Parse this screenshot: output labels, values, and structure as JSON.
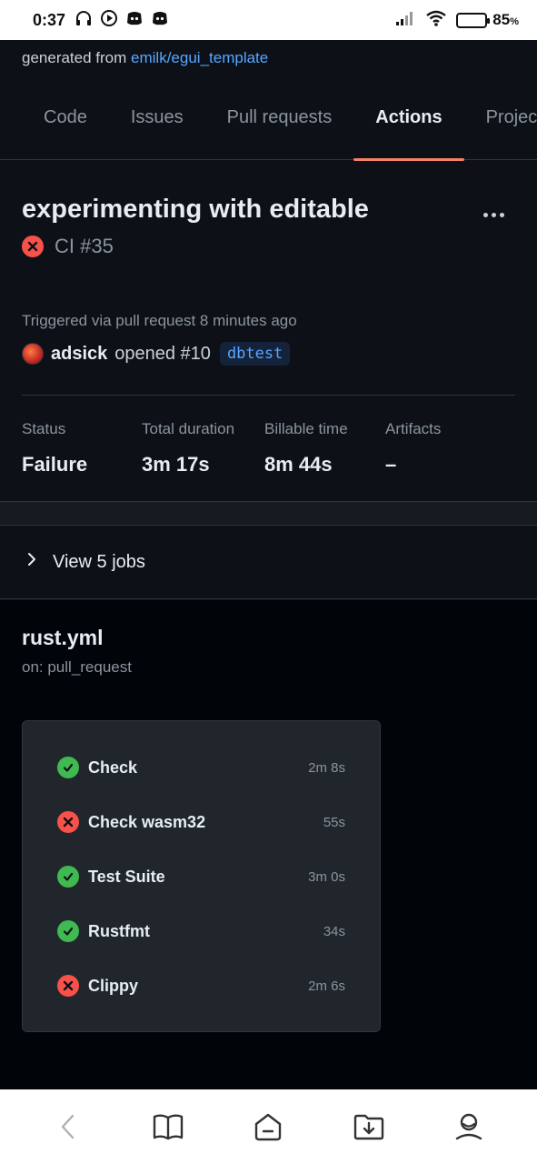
{
  "status_bar": {
    "time": "0:37",
    "battery_percent": "85",
    "battery_unit": "%",
    "icons": [
      "headphones-icon",
      "media-icon",
      "discord-icon",
      "discord-icon",
      "signal-icon",
      "wifi-icon",
      "battery-icon"
    ]
  },
  "repo": {
    "generated_prefix": "generated from",
    "template_link": "emilk/egui_template"
  },
  "tabs": [
    {
      "label": "Code",
      "active": false
    },
    {
      "label": "Issues",
      "active": false
    },
    {
      "label": "Pull requests",
      "active": false
    },
    {
      "label": "Actions",
      "active": true
    },
    {
      "label": "Projects",
      "active": false
    }
  ],
  "run": {
    "title": "experimenting with editable",
    "workflow_run": "CI #35",
    "status_icon": "x-circle-icon",
    "trigger_text": "Triggered via pull request 8 minutes ago",
    "user": "adsick",
    "action": "opened #10",
    "branch": "dbtest"
  },
  "stats": {
    "status_label": "Status",
    "status_value": "Failure",
    "duration_label": "Total duration",
    "duration_value": "3m 17s",
    "billable_label": "Billable time",
    "billable_value": "8m 44s",
    "artifacts_label": "Artifacts",
    "artifacts_value": "–"
  },
  "jobs_toggle": {
    "label": "View 5 jobs"
  },
  "workflow": {
    "file": "rust.yml",
    "trigger": "on: pull_request",
    "jobs": [
      {
        "name": "Check",
        "duration": "2m 8s",
        "status": "success"
      },
      {
        "name": "Check wasm32",
        "duration": "55s",
        "status": "failure"
      },
      {
        "name": "Test Suite",
        "duration": "3m 0s",
        "status": "success"
      },
      {
        "name": "Rustfmt",
        "duration": "34s",
        "status": "success"
      },
      {
        "name": "Clippy",
        "duration": "2m 6s",
        "status": "failure"
      }
    ]
  },
  "colors": {
    "background": "#0d1117",
    "accent_tab": "#f78166",
    "link": "#58a6ff",
    "success": "#3fb950",
    "failure": "#f85149"
  },
  "bottom_nav": [
    "back-icon",
    "book-icon",
    "home-icon",
    "download-icon",
    "profile-icon"
  ]
}
